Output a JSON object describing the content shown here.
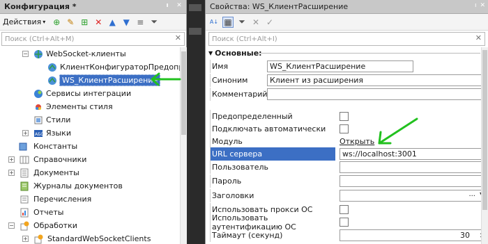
{
  "left_panel": {
    "title": "Конфигурация *",
    "actions_label": "Действия",
    "search_placeholder": "Поиск (Ctrl+Alt+M)",
    "tree": [
      {
        "label": "WebSocket-клиенты",
        "icon": "websocket-icon"
      },
      {
        "label": "КлиентКонфигураторПредопределе",
        "icon": "websocket-client-icon"
      },
      {
        "label": "WS_КлиентРасширение",
        "icon": "websocket-client-icon",
        "selected": true
      },
      {
        "label": "Сервисы интеграции",
        "icon": "integration-icon"
      },
      {
        "label": "Элементы стиля",
        "icon": "style-element-icon"
      },
      {
        "label": "Стили",
        "icon": "styles-icon"
      },
      {
        "label": "Языки",
        "icon": "languages-icon"
      },
      {
        "label": "Константы",
        "icon": "constants-icon"
      },
      {
        "label": "Справочники",
        "icon": "catalogs-icon"
      },
      {
        "label": "Документы",
        "icon": "documents-icon"
      },
      {
        "label": "Журналы документов",
        "icon": "journals-icon"
      },
      {
        "label": "Перечисления",
        "icon": "enums-icon"
      },
      {
        "label": "Отчеты",
        "icon": "reports-icon"
      },
      {
        "label": "Обработки",
        "icon": "dataprocessors-icon"
      },
      {
        "label": "StandardWebSocketClients",
        "icon": "dataprocessor-item-icon"
      }
    ]
  },
  "right_panel": {
    "title": "Свойства: WS_КлиентРасширение",
    "search_placeholder": "Поиск (Ctrl+Alt+I)",
    "section_label": "Основные:",
    "properties": {
      "name_label": "Имя",
      "name_value": "WS_КлиентРасширение",
      "synonym_label": "Синоним",
      "synonym_value": "Клиент из расширения",
      "comment_label": "Комментарий",
      "comment_value": "",
      "predefined_label": "Предопределенный",
      "autoconnect_label": "Подключать автоматически",
      "module_label": "Модуль",
      "module_link": "Открыть",
      "url_label": "URL сервера",
      "url_value": "ws://localhost:3001",
      "user_label": "Пользователь",
      "password_label": "Пароль",
      "headers_label": "Заголовки",
      "headers_button": "...",
      "proxy_label": "Использовать прокси ОС",
      "auth_label": "Использовать аутентификацию ОС",
      "timeout_label": "Таймаут (секунд)",
      "timeout_value": "30"
    }
  },
  "colors": {
    "selection": "#3c6fc4",
    "arrow": "#22c11f"
  }
}
